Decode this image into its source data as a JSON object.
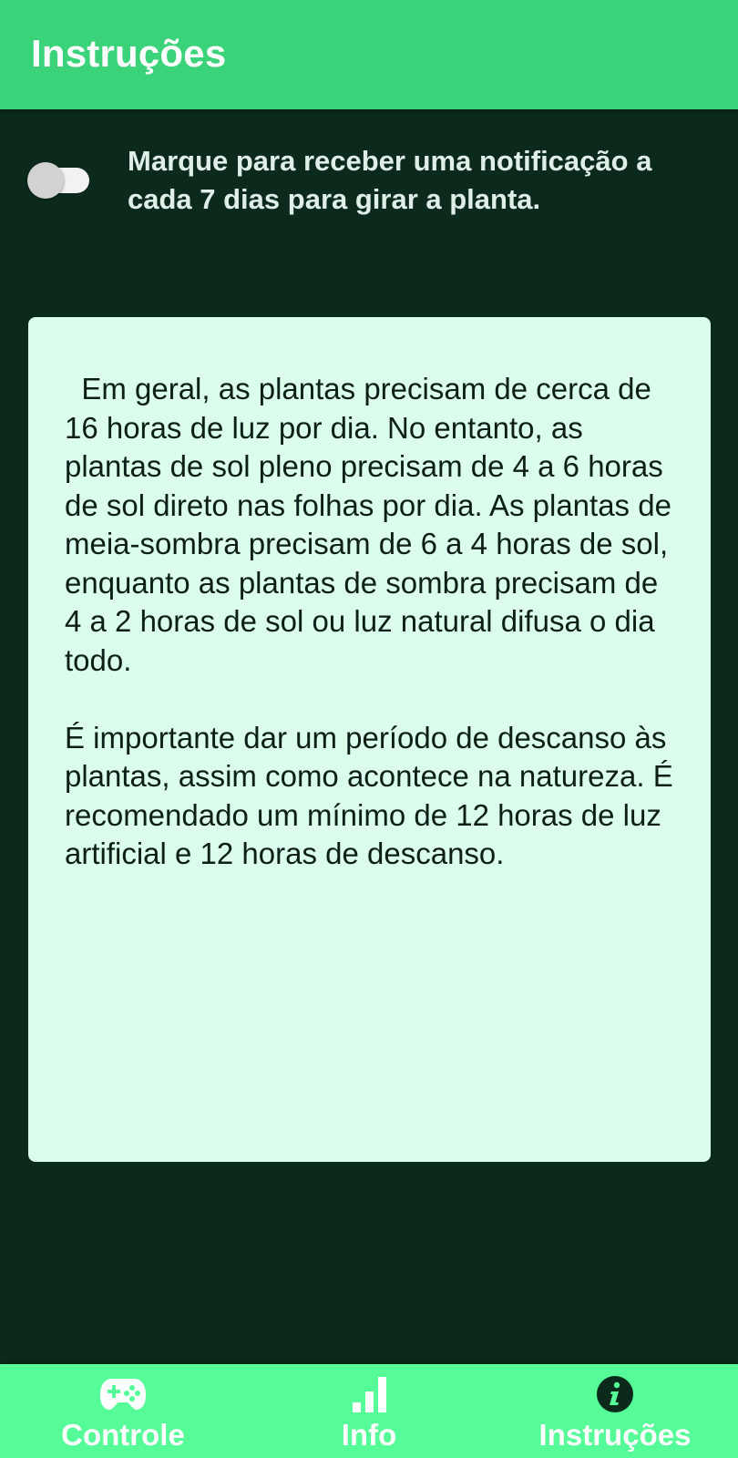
{
  "app_bar": {
    "title": "Instruções",
    "background": "#3ad37a"
  },
  "notification": {
    "toggle_checked": false,
    "label": "Marque para receber uma notificação a cada 7 dias para girar a planta."
  },
  "info_card": {
    "paragraph1": "Em geral, as plantas precisam de cerca de 16 horas de luz por dia. No entanto, as plantas de sol pleno precisam de 4 a 6 horas de sol direto nas folhas por dia. As plantas de meia-sombra precisam de 6 a 4 horas de sol, enquanto as plantas de sombra precisam de 4 a 2 horas de sol ou luz natural difusa o dia todo.",
    "paragraph2": "É importante dar um período de descanso às plantas, assim como acontece na natureza. É recomendado um mínimo de 12 horas de luz artificial e 12 horas de descanso.",
    "background": "#dbfdeb"
  },
  "bottom_nav": {
    "background": "#55fc97",
    "items": [
      {
        "label": "Controle",
        "icon": "gamepad-icon"
      },
      {
        "label": "Info",
        "icon": "bar-chart-icon"
      },
      {
        "label": "Instruções",
        "icon": "info-icon",
        "active": true
      }
    ]
  }
}
